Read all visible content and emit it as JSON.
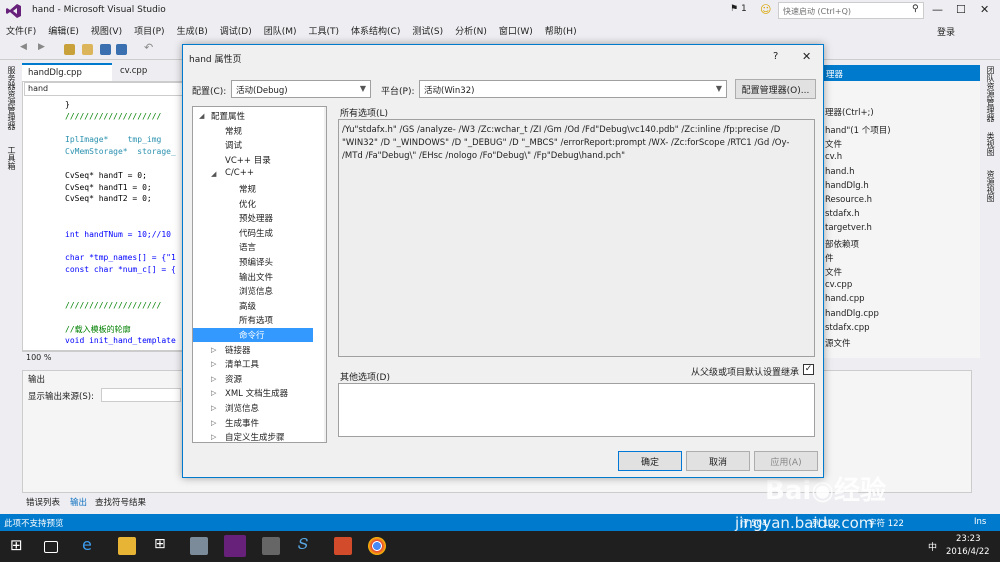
{
  "window": {
    "title": "hand - Microsoft Visual Studio",
    "notif_count": "1",
    "quick_launch": "快速启动 (Ctrl+Q)",
    "signin": "登录",
    "minimize": "—",
    "maximize": "☐",
    "close": "✕"
  },
  "menu": [
    "文件(F)",
    "编辑(E)",
    "视图(V)",
    "项目(P)",
    "生成(B)",
    "调试(D)",
    "团队(M)",
    "工具(T)",
    "体系结构(C)",
    "测试(S)",
    "分析(N)",
    "窗口(W)",
    "帮助(H)"
  ],
  "left_side": {
    "server_explorer": "服务器资源管理器",
    "toolbox": "工具箱"
  },
  "editor": {
    "tabs": [
      "handDlg.cpp",
      "cv.cpp"
    ],
    "nav": "hand",
    "zoom": "100 %",
    "lines": [
      "}",
      "////////////////////",
      "",
      "IplImage*    tmp_img",
      "CvMemStorage*  storage_",
      "",
      "CvSeq* handT = 0;",
      "CvSeq* handT1 = 0;",
      "CvSeq* handT2 = 0;",
      "",
      "",
      "int handTNum = 10;//10",
      "",
      "char *tmp_names[] = {\"1",
      "const char *num_c[] = {",
      "",
      "",
      "////////////////////",
      "",
      "//载入模板的轮廓",
      "void init_hand_template"
    ]
  },
  "output": {
    "title": "输出",
    "source_label": "显示输出来源(S):"
  },
  "bottom_tabs": [
    "错误列表",
    "输出",
    "查找符号结果"
  ],
  "solution": {
    "header": "理器",
    "search": "理器(Ctrl+;)",
    "items": [
      "hand\"(1 个项目)",
      "文件",
      "cv.h",
      "hand.h",
      "handDlg.h",
      "Resource.h",
      "stdafx.h",
      "targetver.h",
      "部依赖项",
      "件",
      "文件",
      "cv.cpp",
      "hand.cpp",
      "handDlg.cpp",
      "stdafx.cpp",
      "源文件"
    ]
  },
  "right_side": {
    "a": "团队资源管理器",
    "b": "类视图",
    "c": "资源视图"
  },
  "status": {
    "text": "此项不支持预览",
    "ln": "行 504",
    "col": "列 122",
    "ch": "字符 122",
    "ins": "Ins"
  },
  "taskbar": {
    "time": "23:23",
    "date": "2016/4/22",
    "ime": "中"
  },
  "dialog": {
    "title": "hand 属性页",
    "help": "?",
    "close": "✕",
    "config_label": "配置(C):",
    "config_value": "活动(Debug)",
    "platform_label": "平台(P):",
    "platform_value": "活动(Win32)",
    "config_mgr": "配置管理器(O)...",
    "tree": [
      {
        "label": "配置属性",
        "level": 0,
        "arrow": "◢"
      },
      {
        "label": "常规",
        "level": 1,
        "arrow": ""
      },
      {
        "label": "调试",
        "level": 1,
        "arrow": ""
      },
      {
        "label": "VC++ 目录",
        "level": 1,
        "arrow": ""
      },
      {
        "label": "C/C++",
        "level": 1,
        "arrow": "◢"
      },
      {
        "label": "常规",
        "level": 2,
        "arrow": ""
      },
      {
        "label": "优化",
        "level": 2,
        "arrow": ""
      },
      {
        "label": "预处理器",
        "level": 2,
        "arrow": ""
      },
      {
        "label": "代码生成",
        "level": 2,
        "arrow": ""
      },
      {
        "label": "语言",
        "level": 2,
        "arrow": ""
      },
      {
        "label": "预编译头",
        "level": 2,
        "arrow": ""
      },
      {
        "label": "输出文件",
        "level": 2,
        "arrow": ""
      },
      {
        "label": "浏览信息",
        "level": 2,
        "arrow": ""
      },
      {
        "label": "高级",
        "level": 2,
        "arrow": ""
      },
      {
        "label": "所有选项",
        "level": 2,
        "arrow": ""
      },
      {
        "label": "命令行",
        "level": 2,
        "arrow": "",
        "selected": true
      },
      {
        "label": "链接器",
        "level": 1,
        "arrow": "▷"
      },
      {
        "label": "清单工具",
        "level": 1,
        "arrow": "▷"
      },
      {
        "label": "资源",
        "level": 1,
        "arrow": "▷"
      },
      {
        "label": "XML 文档生成器",
        "level": 1,
        "arrow": "▷"
      },
      {
        "label": "浏览信息",
        "level": 1,
        "arrow": "▷"
      },
      {
        "label": "生成事件",
        "level": 1,
        "arrow": "▷"
      },
      {
        "label": "自定义生成步骤",
        "level": 1,
        "arrow": "▷"
      }
    ],
    "all_options_label": "所有选项(L)",
    "all_options_text": "/Yu\"stdafx.h\" /GS /analyze- /W3 /Zc:wchar_t /ZI /Gm /Od /Fd\"Debug\\vc140.pdb\" /Zc:inline /fp:precise /D \"WIN32\" /D \"_WINDOWS\" /D \"_DEBUG\" /D \"_MBCS\" /errorReport:prompt /WX- /Zc:forScope /RTC1 /Gd /Oy- /MTd /Fa\"Debug\\\" /EHsc /nologo /Fo\"Debug\\\" /Fp\"Debug\\hand.pch\"",
    "other_options_label": "其他选项(D)",
    "inherit_label": "从父级或项目默认设置继承",
    "ok": "确定",
    "cancel": "取消",
    "apply": "应用(A)"
  },
  "watermark": {
    "brand": "Bai◉经验",
    "site": "jingyan.baidu.com"
  }
}
